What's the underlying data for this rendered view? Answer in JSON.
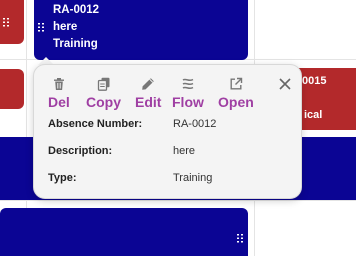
{
  "colors": {
    "event_navy": "#0b0594",
    "event_red": "#b3292b",
    "action_purple": "#9f3fa3",
    "popup_bg": "#f4f4f4"
  },
  "events": {
    "main": {
      "line1": "RA-0012",
      "line2": "here",
      "line3": "Training"
    },
    "right": {
      "line1": "0015",
      "line2": "ical"
    }
  },
  "popup": {
    "actions": [
      {
        "label": "Del",
        "icon": "trash-icon"
      },
      {
        "label": "Copy",
        "icon": "copy-icon"
      },
      {
        "label": "Edit",
        "icon": "pencil-icon"
      },
      {
        "label": "Flow",
        "icon": "flow-icon"
      },
      {
        "label": "Open",
        "icon": "open-external-icon"
      }
    ],
    "close_icon": "close-icon",
    "fields": [
      {
        "label": "Absence Number:",
        "value": "RA-0012"
      },
      {
        "label": "Description:",
        "value": "here"
      },
      {
        "label": "Type:",
        "value": "Training"
      }
    ]
  }
}
